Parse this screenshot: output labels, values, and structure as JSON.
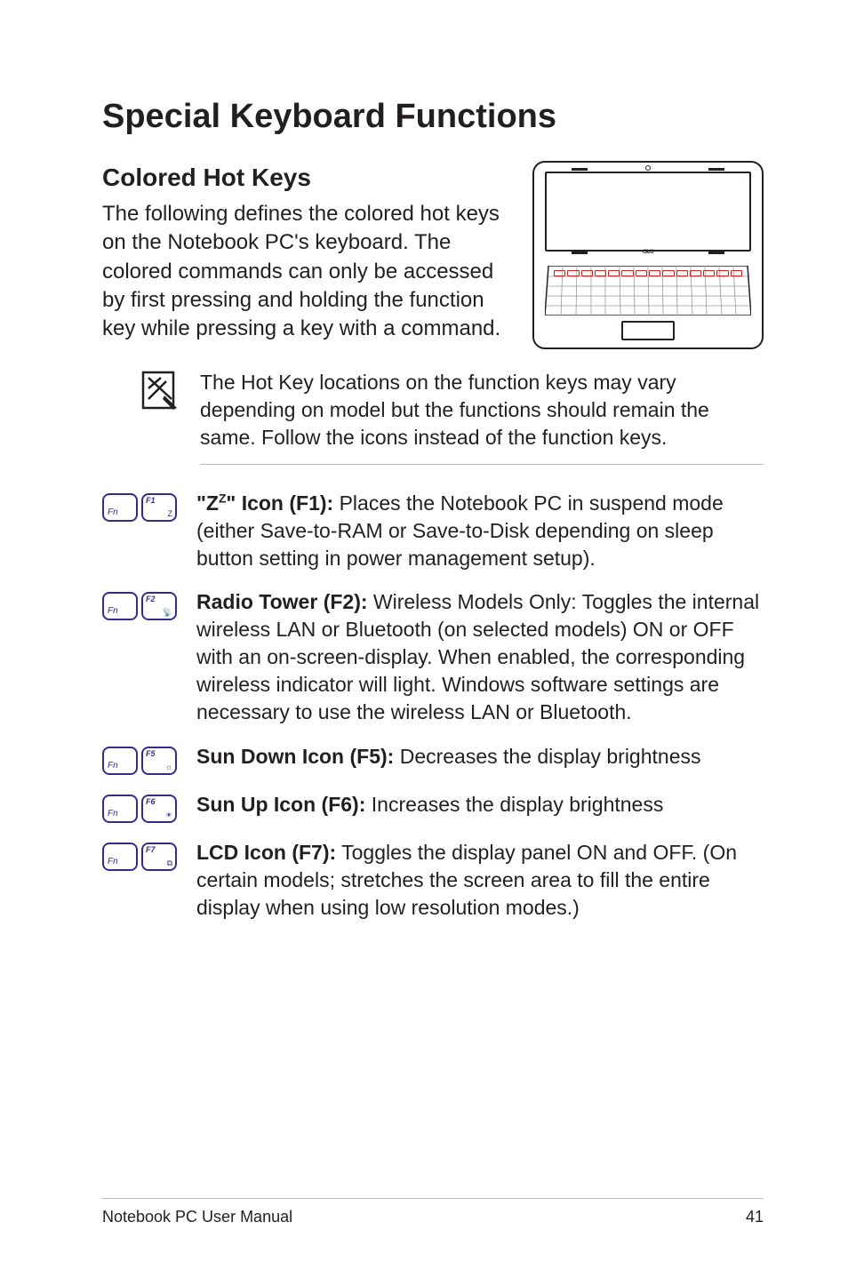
{
  "title": "Special Keyboard Functions",
  "section_heading": "Colored Hot Keys",
  "intro": "The following defines the colored hot keys on the Notebook PC's keyboard. The colored commands can only be accessed by first pressing and holding the function key while pressing a key with a command.",
  "note": "The Hot Key locations on the function keys may vary depending on model but the functions should remain the same. Follow the icons instead of the function keys.",
  "items": [
    {
      "fkey": "F1",
      "icon_label": "Z",
      "title_html": "\"Z<sup>Z</sup>\" Icon (F1):",
      "body": " Places the Notebook PC in suspend mode (either Save-to-RAM or Save-to-Disk depending on sleep button setting in power management setup)."
    },
    {
      "fkey": "F2",
      "icon_label": "📡",
      "title_html": "Radio Tower (F2):",
      "body": " Wireless Models Only: Toggles the internal wireless LAN or Bluetooth (on selected models) ON or OFF with an on-screen-display. When enabled, the corresponding wireless indicator will light. Windows software settings are necessary to use the wireless LAN or Bluetooth."
    },
    {
      "fkey": "F5",
      "icon_label": "☼",
      "title_html": "Sun Down Icon (F5):",
      "body": " Decreases the display brightness"
    },
    {
      "fkey": "F6",
      "icon_label": "☀",
      "title_html": "Sun Up Icon (F6):",
      "body": " Increases the display brightness"
    },
    {
      "fkey": "F7",
      "icon_label": "⧉",
      "title_html": "LCD Icon (F7):",
      "body": " Toggles the display panel ON and OFF. (On certain models; stretches the screen area to fill the entire display when using low resolution modes.)"
    }
  ],
  "footer_left": "Notebook PC User Manual",
  "footer_right": "41",
  "fn_label": "Fn"
}
